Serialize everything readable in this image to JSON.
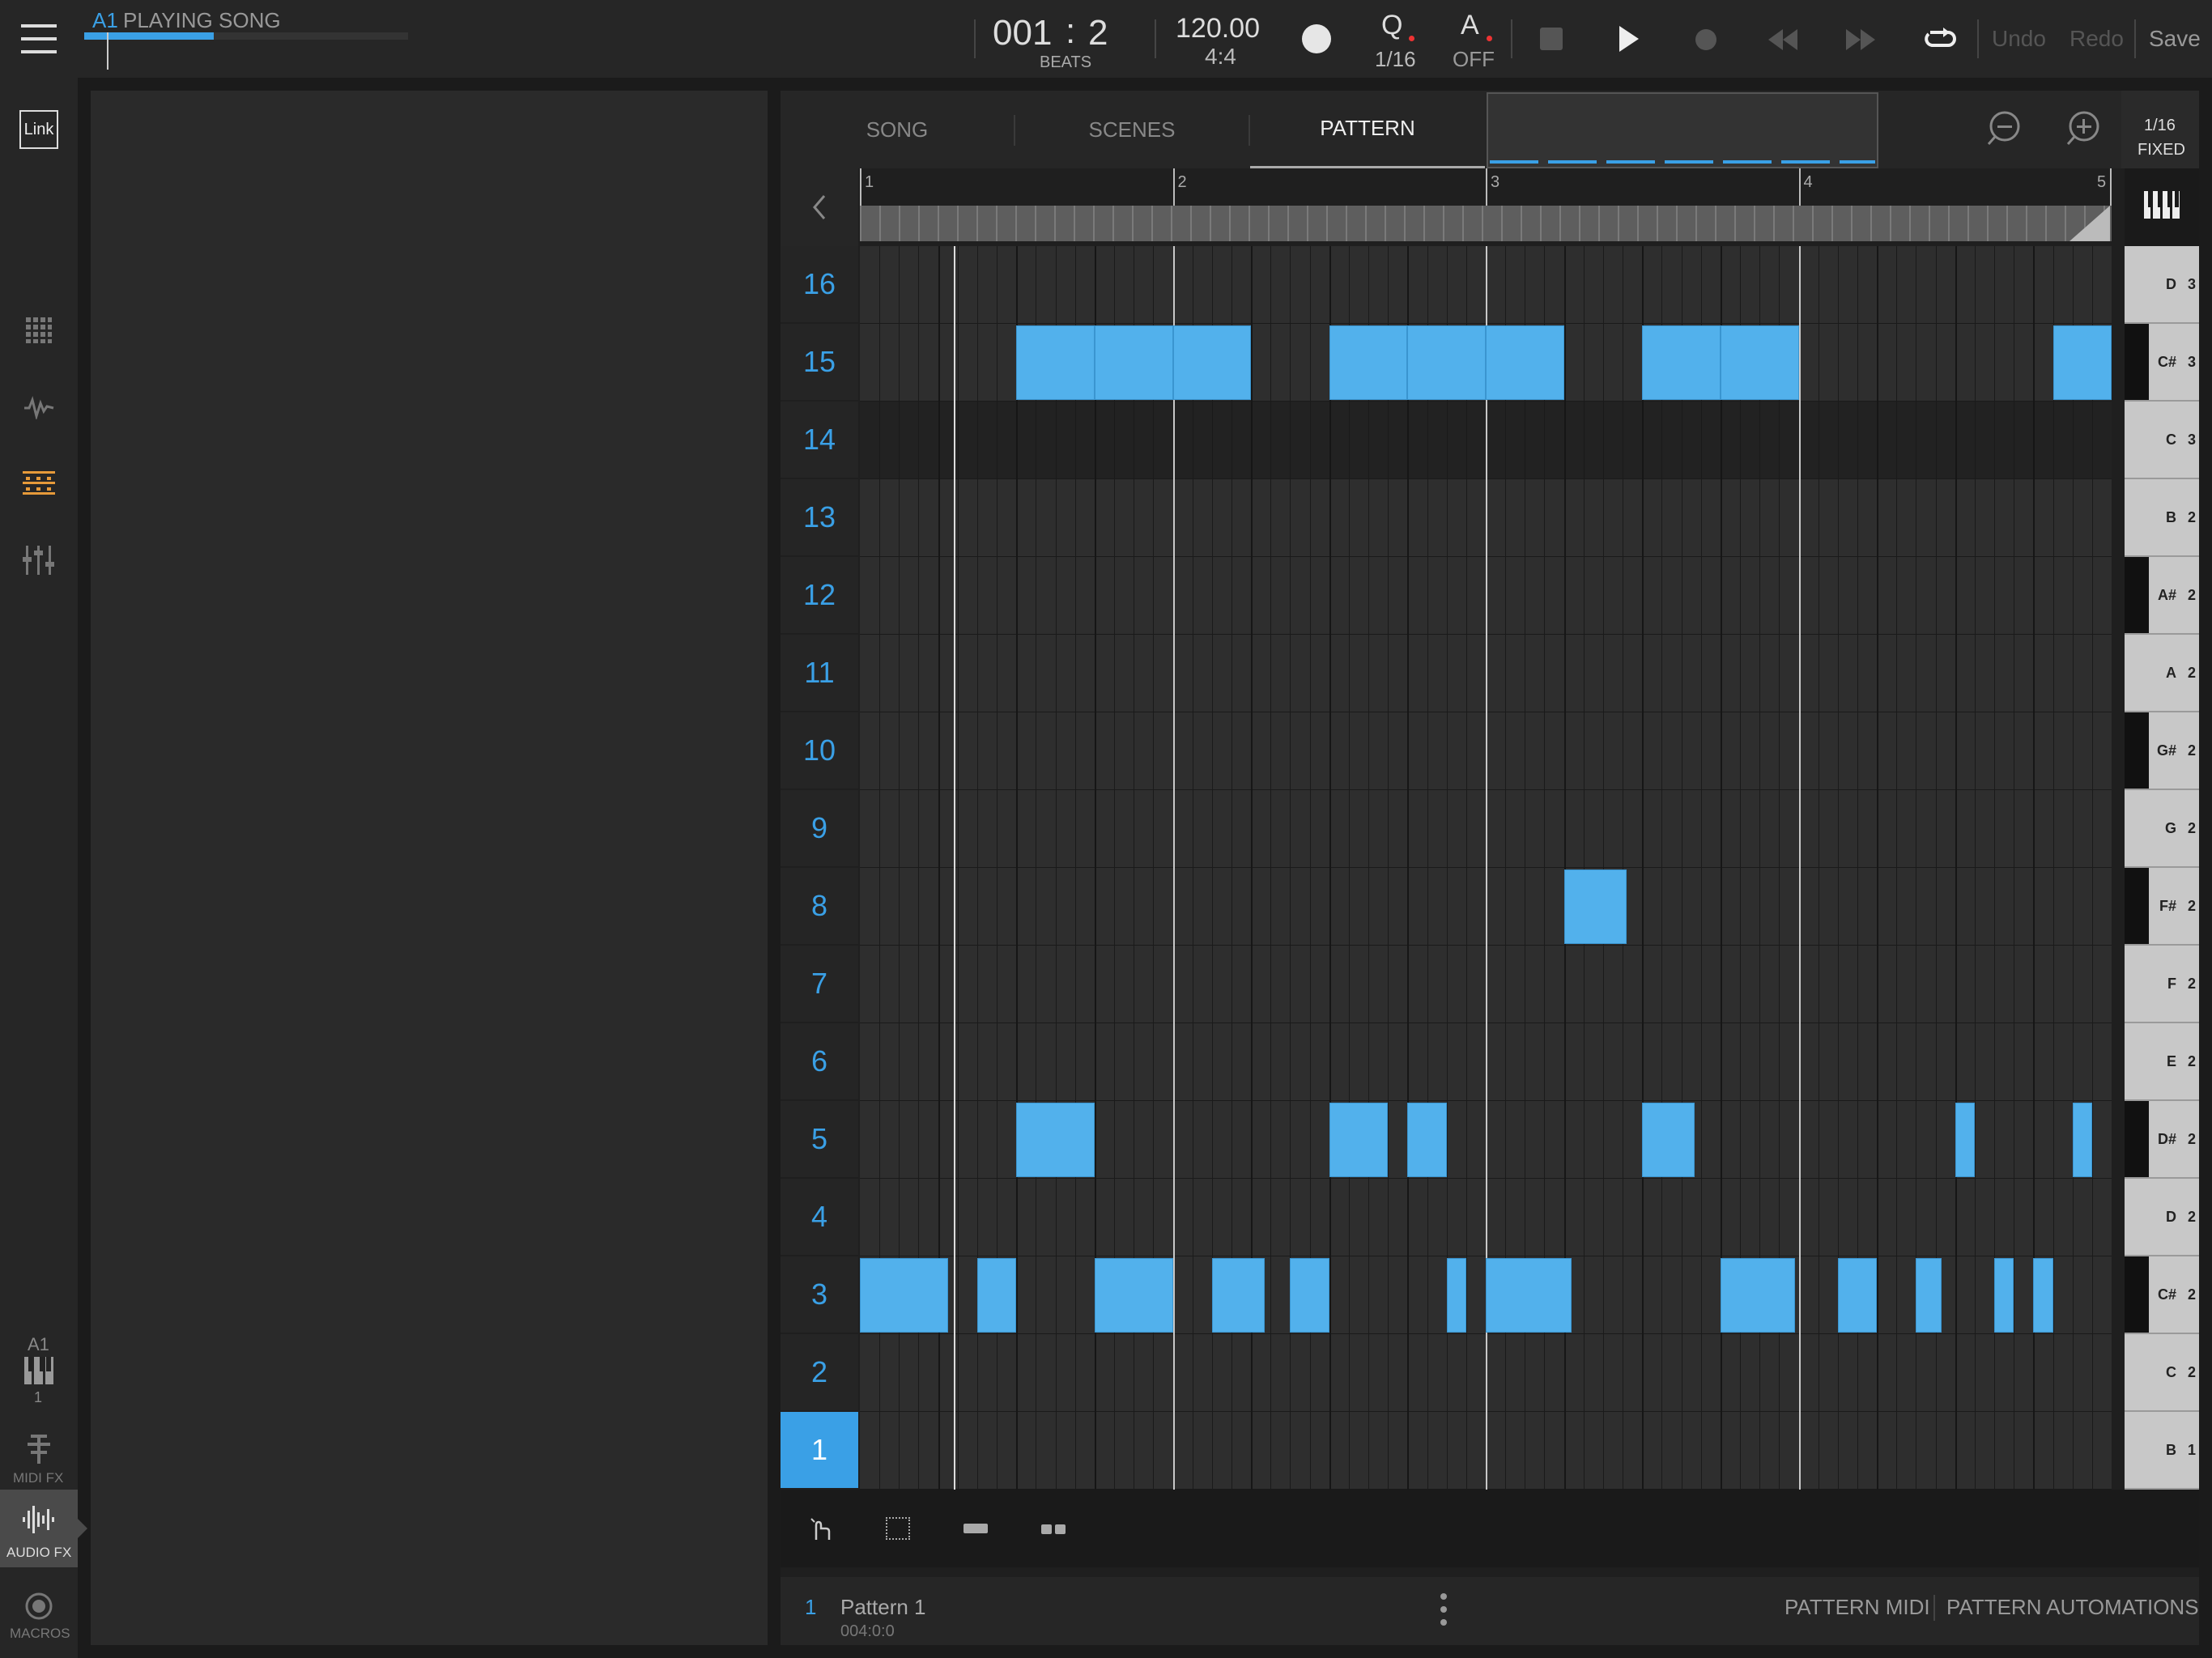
{
  "topbar": {
    "track_id": "A1",
    "track_status": "PLAYING SONG",
    "position_bars": "001",
    "position_sep": ":",
    "position_beats": "2",
    "position_unit": "BEATS",
    "tempo": "120.00",
    "time_signature": "4:4",
    "quantize_label": "Q",
    "quantize_value": "1/16",
    "auto_label": "A",
    "auto_value": "OFF",
    "undo": "Undo",
    "redo": "Redo",
    "save": "Save",
    "song_progress": 0.4
  },
  "sidebar": {
    "link_label": "Link",
    "track_slot": "A1",
    "track_number": "1",
    "midi_fx": "MIDI FX",
    "audio_fx": "AUDIO FX",
    "macros": "MACROS"
  },
  "editor": {
    "tabs": [
      {
        "label": "SONG",
        "active": false
      },
      {
        "label": "SCENES",
        "active": false
      },
      {
        "label": "PATTERN",
        "active": true
      }
    ],
    "grid_setting": "1/16",
    "grid_mode": "FIXED",
    "ruler_bars": [
      "1",
      "2",
      "3",
      "4",
      "5"
    ],
    "pads": [
      "16",
      "15",
      "14",
      "13",
      "12",
      "11",
      "10",
      "9",
      "8",
      "7",
      "6",
      "5",
      "4",
      "3",
      "2",
      "1"
    ],
    "selected_pad": "1",
    "keys": [
      {
        "note": "D",
        "octave": "3",
        "black": false
      },
      {
        "note": "C#",
        "octave": "3",
        "black": true
      },
      {
        "note": "C",
        "octave": "3",
        "black": false
      },
      {
        "note": "B",
        "octave": "2",
        "black": false
      },
      {
        "note": "A#",
        "octave": "2",
        "black": true
      },
      {
        "note": "A",
        "octave": "2",
        "black": false
      },
      {
        "note": "G#",
        "octave": "2",
        "black": true
      },
      {
        "note": "G",
        "octave": "2",
        "black": false
      },
      {
        "note": "F#",
        "octave": "2",
        "black": true
      },
      {
        "note": "F",
        "octave": "2",
        "black": false
      },
      {
        "note": "E",
        "octave": "2",
        "black": false
      },
      {
        "note": "D#",
        "octave": "2",
        "black": true
      },
      {
        "note": "D",
        "octave": "2",
        "black": false
      },
      {
        "note": "C#",
        "octave": "2",
        "black": true
      },
      {
        "note": "C",
        "octave": "2",
        "black": false
      },
      {
        "note": "B",
        "octave": "1",
        "black": false
      }
    ],
    "notes": [
      {
        "pad": 15,
        "start": 2.0,
        "len": 1.0
      },
      {
        "pad": 15,
        "start": 3.0,
        "len": 1.0
      },
      {
        "pad": 15,
        "start": 4.0,
        "len": 1.0
      },
      {
        "pad": 15,
        "start": 6.0,
        "len": 1.0
      },
      {
        "pad": 15,
        "start": 7.0,
        "len": 1.0
      },
      {
        "pad": 15,
        "start": 8.0,
        "len": 1.0
      },
      {
        "pad": 15,
        "start": 10.0,
        "len": 1.0
      },
      {
        "pad": 15,
        "start": 11.0,
        "len": 1.0
      },
      {
        "pad": 15,
        "start": 15.25,
        "len": 0.75
      },
      {
        "pad": 8,
        "start": 9.0,
        "len": 0.8
      },
      {
        "pad": 5,
        "start": 2.0,
        "len": 1.0
      },
      {
        "pad": 5,
        "start": 6.0,
        "len": 0.75
      },
      {
        "pad": 5,
        "start": 7.0,
        "len": 0.5
      },
      {
        "pad": 5,
        "start": 10.0,
        "len": 0.67
      },
      {
        "pad": 5,
        "start": 14.0,
        "len": 0.25
      },
      {
        "pad": 5,
        "start": 15.5,
        "len": 0.25
      },
      {
        "pad": 3,
        "start": 0.0,
        "len": 1.125
      },
      {
        "pad": 3,
        "start": 1.5,
        "len": 0.5
      },
      {
        "pad": 3,
        "start": 3.0,
        "len": 1.0
      },
      {
        "pad": 3,
        "start": 4.5,
        "len": 0.67
      },
      {
        "pad": 3,
        "start": 5.5,
        "len": 0.5
      },
      {
        "pad": 3,
        "start": 7.5,
        "len": 0.25
      },
      {
        "pad": 3,
        "start": 8.0,
        "len": 1.1
      },
      {
        "pad": 3,
        "start": 11.0,
        "len": 0.95
      },
      {
        "pad": 3,
        "start": 12.5,
        "len": 0.5
      },
      {
        "pad": 3,
        "start": 13.5,
        "len": 0.33
      },
      {
        "pad": 3,
        "start": 14.5,
        "len": 0.25
      },
      {
        "pad": 3,
        "start": 15.0,
        "len": 0.25
      }
    ],
    "pattern_index": "1",
    "pattern_name": "Pattern 1",
    "pattern_length": "004:0:0",
    "pattern_midi": "PATTERN MIDI",
    "pattern_automations": "PATTERN AUTOMATIONS"
  },
  "colors": {
    "accent": "#3aa0e6",
    "note": "#52b1ec",
    "background": "#1b1b1b",
    "panel": "#262626"
  }
}
